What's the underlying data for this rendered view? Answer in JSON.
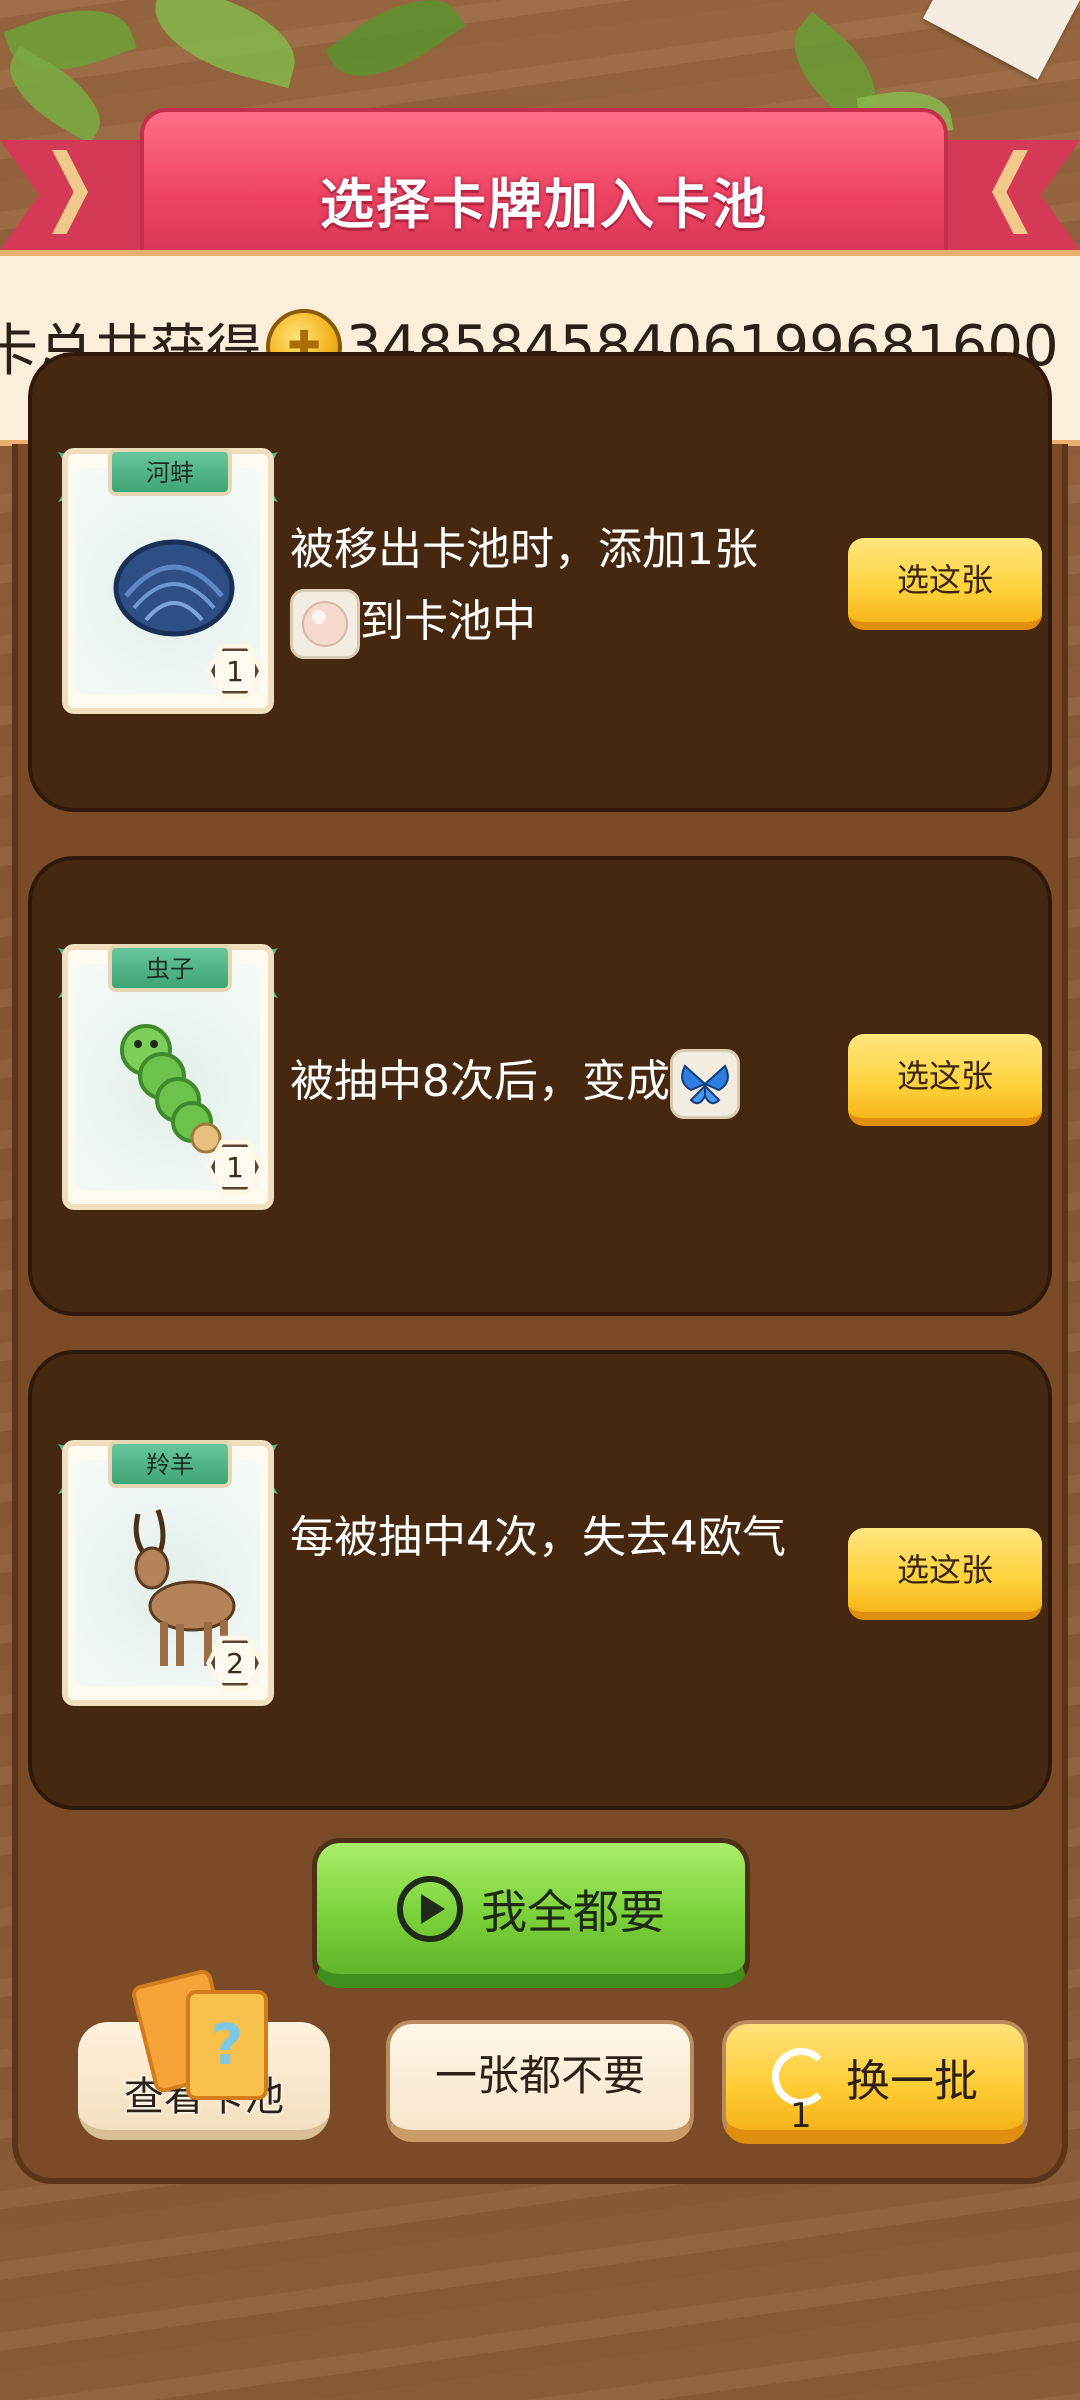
{
  "header": {
    "title": "选择卡牌加入卡池"
  },
  "total": {
    "prefix": "卡总共获得",
    "coin_icon": "coin-icon",
    "value": "34858458406199681600"
  },
  "cards": [
    {
      "name": "河蚌",
      "level": "1",
      "art_icon": "clam-icon",
      "desc_pre": "被移出卡池时，添加1张",
      "desc_icon": "pearl-icon",
      "desc_post": "到卡池中",
      "button": "选这张"
    },
    {
      "name": "虫子",
      "level": "1",
      "art_icon": "caterpillar-icon",
      "desc_pre": "被抽中8次后，变成",
      "desc_icon": "butterfly-icon",
      "desc_post": "",
      "button": "选这张"
    },
    {
      "name": "羚羊",
      "level": "2",
      "art_icon": "antelope-icon",
      "desc_pre": "每被抽中4次，失去4欧气",
      "desc_icon": "",
      "desc_post": "",
      "button": "选这张"
    }
  ],
  "actions": {
    "take_all": "我全都要",
    "view_pool": "查看卡池",
    "take_none": "一张都不要",
    "refresh": "换一批",
    "refresh_count": "1"
  },
  "colors": {
    "panel": "#46270f",
    "board": "#7b4a26",
    "banner": "#ee4464",
    "gold_button": "#ffd23c",
    "green_button": "#7bd23a"
  }
}
